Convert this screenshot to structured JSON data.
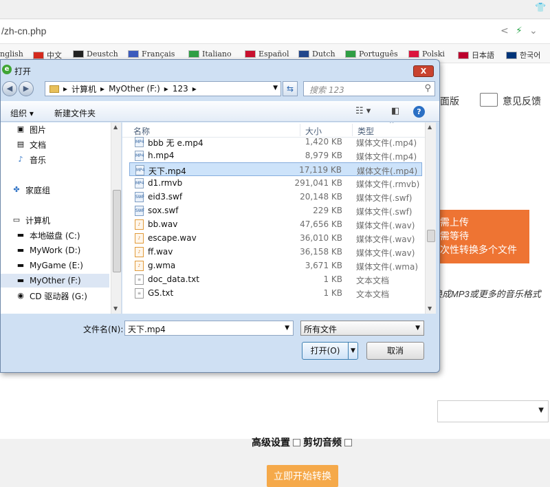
{
  "browser": {
    "url_fragment": "/zh-cn.php",
    "languages": [
      {
        "label": "nglish",
        "flag": "#2b3f8f"
      },
      {
        "label": "中文",
        "flag": "#d52b1e"
      },
      {
        "label": "Deustch",
        "flag": "#222222"
      },
      {
        "label": "Français",
        "flag": "#3b5bbd"
      },
      {
        "label": "Italiano",
        "flag": "#2f9e44"
      },
      {
        "label": "Español",
        "flag": "#c8102e"
      },
      {
        "label": "Dutch",
        "flag": "#21468b"
      },
      {
        "label": "Português",
        "flag": "#2f9e44"
      },
      {
        "label": "Polski",
        "flag": "#dc143c"
      },
      {
        "label": "日本語",
        "flag": "#bc002d"
      },
      {
        "label": "한국어",
        "flag": "#003478"
      }
    ]
  },
  "page": {
    "link_partial": "面版",
    "feedback": "意见反馈",
    "orange_lines": [
      "需上传",
      "需等待",
      "次性转换多个文件"
    ],
    "desc_partial": "换成MP3或更多的音乐格式",
    "advanced": "高级设置",
    "cut_audio": "剪切音频",
    "start_button": "立即开始转换"
  },
  "dialog": {
    "title": "打开",
    "close": "X",
    "breadcrumb": [
      "计算机",
      "MyOther (F:)",
      "123"
    ],
    "search_placeholder": "搜索 123",
    "organize": "组织 ▾",
    "new_folder": "新建文件夹",
    "nav": [
      {
        "label": "图片",
        "icon": "pictures-icon"
      },
      {
        "label": "文档",
        "icon": "documents-icon"
      },
      {
        "label": "音乐",
        "icon": "music-icon"
      },
      {
        "label": "家庭组",
        "icon": "homegroup-icon"
      },
      {
        "label": "计算机",
        "icon": "computer-icon"
      },
      {
        "label": "本地磁盘 (C:)",
        "icon": "drive-icon"
      },
      {
        "label": "MyWork (D:)",
        "icon": "drive-icon"
      },
      {
        "label": "MyGame (E:)",
        "icon": "drive-icon"
      },
      {
        "label": "MyOther (F:)",
        "icon": "drive-icon"
      },
      {
        "label": "CD 驱动器 (G:)",
        "icon": "cd-drive-icon"
      }
    ],
    "columns": {
      "name": "名称",
      "size": "大小",
      "type": "类型"
    },
    "files": [
      {
        "name": "bbb 无 e.mp4",
        "size": "1,420 KB",
        "type": "媒体文件(.mp4)",
        "kind": "video"
      },
      {
        "name": "h.mp4",
        "size": "8,979 KB",
        "type": "媒体文件(.mp4)",
        "kind": "video"
      },
      {
        "name": "天下.mp4",
        "size": "17,119 KB",
        "type": "媒体文件(.mp4)",
        "kind": "video"
      },
      {
        "name": "d1.rmvb",
        "size": "291,041 KB",
        "type": "媒体文件(.rmvb)",
        "kind": "video"
      },
      {
        "name": "eid3.swf",
        "size": "20,148 KB",
        "type": "媒体文件(.swf)",
        "kind": "swf"
      },
      {
        "name": "sox.swf",
        "size": "229 KB",
        "type": "媒体文件(.swf)",
        "kind": "swf"
      },
      {
        "name": "bb.wav",
        "size": "47,656 KB",
        "type": "媒体文件(.wav)",
        "kind": "audio"
      },
      {
        "name": "escape.wav",
        "size": "36,010 KB",
        "type": "媒体文件(.wav)",
        "kind": "audio"
      },
      {
        "name": "ff.wav",
        "size": "36,158 KB",
        "type": "媒体文件(.wav)",
        "kind": "audio"
      },
      {
        "name": "g.wma",
        "size": "3,671 KB",
        "type": "媒体文件(.wma)",
        "kind": "audio"
      },
      {
        "name": "doc_data.txt",
        "size": "1 KB",
        "type": "文本文档",
        "kind": "txt"
      },
      {
        "name": "GS.txt",
        "size": "1 KB",
        "type": "文本文档",
        "kind": "txt"
      }
    ],
    "selected_file_index": 2,
    "filename_label": "文件名(N):",
    "filename_value": "天下.mp4",
    "filetype_value": "所有文件",
    "open_button": "打开(O)",
    "cancel_button": "取消"
  }
}
